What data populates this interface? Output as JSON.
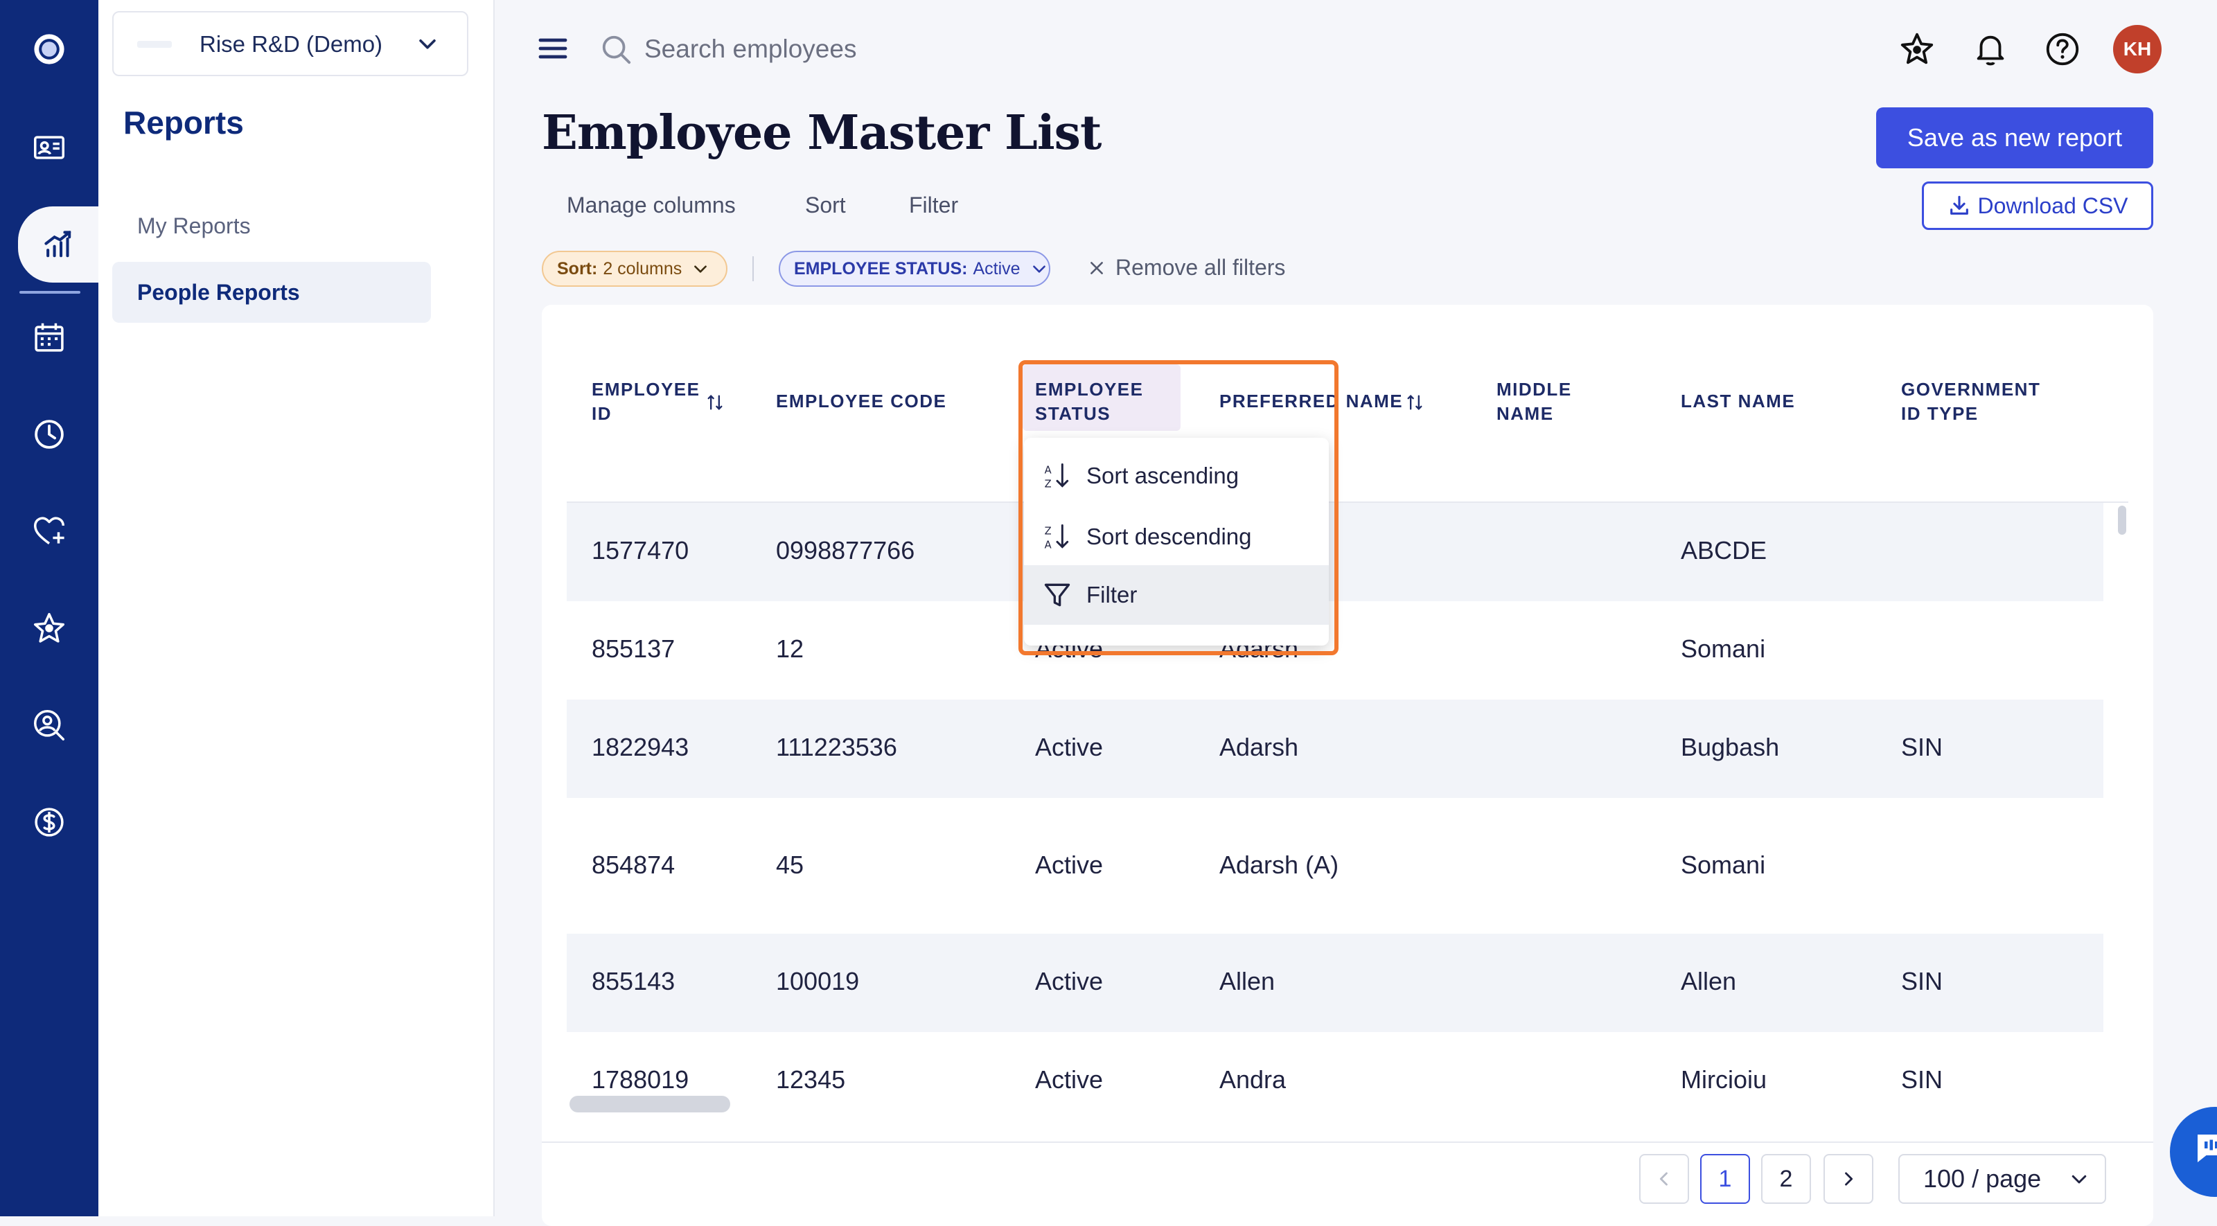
{
  "app": {
    "org_name": "Rise R&D (Demo)",
    "nav_icons": [
      "logo-icon",
      "people-card-icon",
      "reports-chart-icon",
      "calendar-icon",
      "clock-icon",
      "heart-plus-icon",
      "star-icon",
      "user-search-icon",
      "dollar-icon"
    ],
    "active_nav": "reports-chart-icon"
  },
  "sidebar": {
    "title": "Reports",
    "items": [
      {
        "label": "My Reports",
        "active": false
      },
      {
        "label": "People Reports",
        "active": true
      }
    ]
  },
  "topbar": {
    "search_placeholder": "Search employees",
    "avatar_initials": "KH"
  },
  "header": {
    "title": "Employee Master List",
    "save_button": "Save as new report",
    "download_button": "Download CSV",
    "toolbar": [
      "Manage columns",
      "Sort",
      "Filter"
    ]
  },
  "chips": {
    "sort_key": "Sort:",
    "sort_value": "2 columns",
    "status_key": "EMPLOYEE STATUS:",
    "status_value": "Active",
    "remove_all": "Remove all filters"
  },
  "table": {
    "columns": [
      {
        "label": "EMPLOYEE ID",
        "sortable": true
      },
      {
        "label": "EMPLOYEE CODE",
        "sortable": false
      },
      {
        "label": "EMPLOYEE STATUS",
        "sortable": false
      },
      {
        "label": "PREFERRED NAME",
        "sortable": true
      },
      {
        "label": "MIDDLE NAME",
        "sortable": false
      },
      {
        "label": "LAST NAME",
        "sortable": false
      },
      {
        "label": "GOVERNMENT ID TYPE",
        "sortable": false
      }
    ],
    "rows": [
      {
        "id": "1577470",
        "code": "0998877766",
        "status": "",
        "preferred": "",
        "middle": "",
        "last": "ABCDE",
        "gov": ""
      },
      {
        "id": "855137",
        "code": "12",
        "status": "Active",
        "preferred": "Adarsh",
        "middle": "",
        "last": "Somani",
        "gov": ""
      },
      {
        "id": "1822943",
        "code": "111223536",
        "status": "Active",
        "preferred": "Adarsh",
        "middle": "",
        "last": "Bugbash",
        "gov": "SIN"
      },
      {
        "id": "854874",
        "code": "45",
        "status": "Active",
        "preferred": "Adarsh (A)",
        "middle": "",
        "last": "Somani",
        "gov": ""
      },
      {
        "id": "855143",
        "code": "100019",
        "status": "Active",
        "preferred": "Allen",
        "middle": "",
        "last": "Allen",
        "gov": "SIN"
      },
      {
        "id": "1788019",
        "code": "12345",
        "status": "Active",
        "preferred": "Andra",
        "middle": "",
        "last": "Mircioiu",
        "gov": "SIN"
      }
    ]
  },
  "dropdown": {
    "items": [
      "Sort ascending",
      "Sort descending",
      "Filter"
    ],
    "hovered": "Filter"
  },
  "pagination": {
    "pages": [
      "1",
      "2"
    ],
    "current": "1",
    "page_size": "100 / page"
  },
  "colors": {
    "rail": "#0e2a7a",
    "accent": "#3c4fe0",
    "highlight_outline": "#f2782e",
    "avatar": "#c1402b"
  }
}
